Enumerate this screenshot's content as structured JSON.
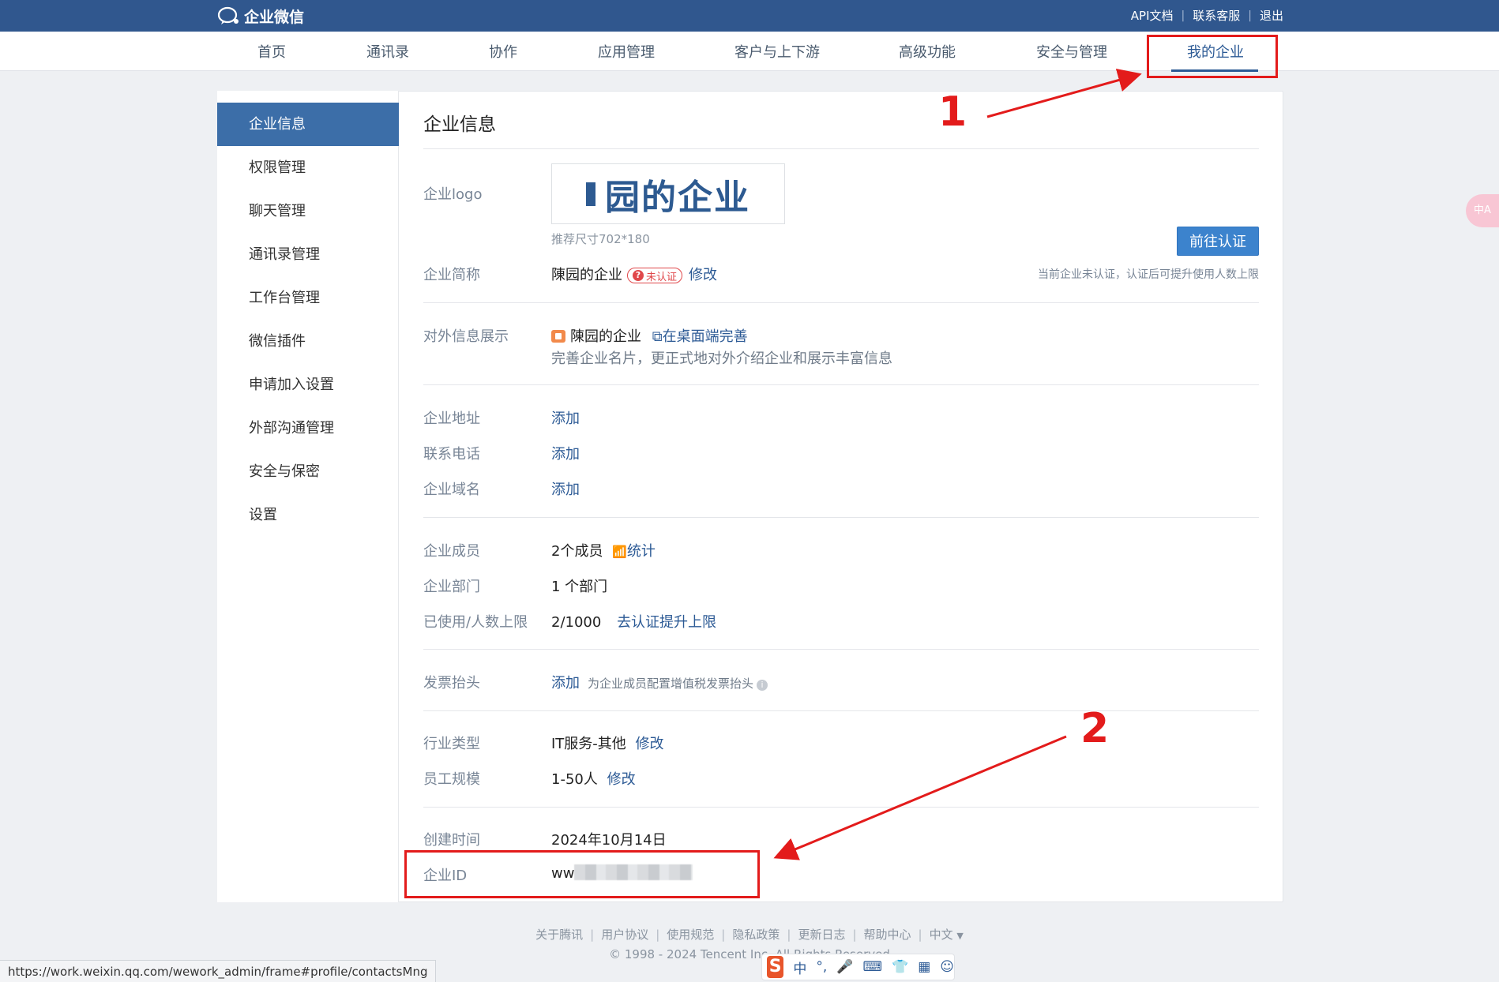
{
  "app": {
    "name": "企业微信",
    "top_links": [
      "API文档",
      "联系客服",
      "退出"
    ]
  },
  "nav": {
    "items": [
      "首页",
      "通讯录",
      "协作",
      "应用管理",
      "客户与上下游",
      "高级功能",
      "安全与管理",
      "我的企业"
    ],
    "active": "我的企业"
  },
  "sidebar": {
    "items": [
      "企业信息",
      "权限管理",
      "聊天管理",
      "通讯录管理",
      "工作台管理",
      "微信插件",
      "申请加入设置",
      "外部沟通管理",
      "安全与保密",
      "设置"
    ],
    "active": "企业信息"
  },
  "content": {
    "title": "企业信息",
    "logo": {
      "label": "企业logo",
      "image_text": "园的企业",
      "hint": "推荐尺寸702*180"
    },
    "cert_button": "前往认证",
    "cert_note": "当前企业未认证，认证后可提升使用人数上限",
    "short_name": {
      "label": "企业简称",
      "value": "陳园的企业",
      "badge": "未认证",
      "action": "修改"
    },
    "external": {
      "label": "对外信息展示",
      "name": "陳园的企业",
      "link": "在桌面端完善",
      "desc": "完善企业名片，更正式地对外介绍企业和展示丰富信息"
    },
    "address": {
      "label": "企业地址",
      "action": "添加"
    },
    "phone": {
      "label": "联系电话",
      "action": "添加"
    },
    "domain": {
      "label": "企业域名",
      "action": "添加"
    },
    "members": {
      "label": "企业成员",
      "value": "2个成员",
      "action": "统计"
    },
    "departments": {
      "label": "企业部门",
      "value": "1 个部门"
    },
    "usage": {
      "label": "已使用/人数上限",
      "value": "2/1000",
      "action": "去认证提升上限"
    },
    "invoice": {
      "label": "发票抬头",
      "action": "添加",
      "note": "为企业成员配置增值税发票抬头"
    },
    "industry": {
      "label": "行业类型",
      "value": "IT服务-其他",
      "action": "修改"
    },
    "staff_size": {
      "label": "员工规模",
      "value": "1-50人",
      "action": "修改"
    },
    "created": {
      "label": "创建时间",
      "value": "2024年10月14日"
    },
    "corp_id": {
      "label": "企业ID",
      "value": "ww"
    }
  },
  "footer": {
    "links": [
      "关于腾讯",
      "用户协议",
      "使用规范",
      "隐私政策",
      "更新日志",
      "帮助中心",
      "中文"
    ],
    "copyright": "© 1998 - 2024 Tencent Inc. All Rights Reserved"
  },
  "statusbar": {
    "url": "https://work.weixin.qq.com/wework_admin/frame#profile/contactsMng"
  },
  "ime": {
    "logo": "S",
    "mode": "中"
  },
  "translate_button": "中A",
  "annotations": {
    "first": "1",
    "second": "2"
  },
  "colors": {
    "topbar": "#30578e",
    "accent": "#3c6ea8",
    "link": "#2c5a95",
    "annotation": "#e31b1b",
    "danger": "#e0484b"
  }
}
